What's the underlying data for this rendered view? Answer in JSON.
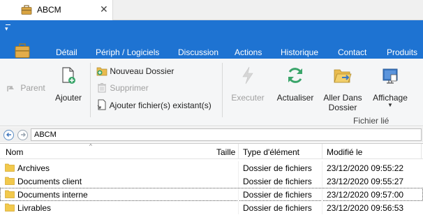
{
  "window": {
    "tab_title": "ABCM",
    "tab_close": "✕"
  },
  "ribbon": {
    "tabs": [
      "Détail",
      "Périph / Logiciels",
      "Discussion",
      "Actions",
      "Historique",
      "Contact",
      "Produits"
    ],
    "buttons": {
      "parent": "Parent",
      "ajouter": "Ajouter",
      "nouveau_dossier": "Nouveau Dossier",
      "supprimer": "Supprimer",
      "ajouter_fichiers": "Ajouter fichier(s) existant(s)",
      "executer": "Executer",
      "actualiser": "Actualiser",
      "aller_dans_1": "Aller Dans",
      "aller_dans_2": "Dossier",
      "affichage": "Affichage"
    },
    "group_label": "Fichier lié"
  },
  "address": {
    "value": "ABCM"
  },
  "list": {
    "columns": {
      "name": "Nom",
      "size": "Taille",
      "type": "Type d'élément",
      "modified": "Modifié le"
    },
    "rows": [
      {
        "name": "Archives",
        "size": "",
        "type": "Dossier de fichiers",
        "modified": "23/12/2020 09:55:22"
      },
      {
        "name": "Documents client",
        "size": "",
        "type": "Dossier de fichiers",
        "modified": "23/12/2020 09:55:27"
      },
      {
        "name": "Documents interne",
        "size": "",
        "type": "Dossier de fichiers",
        "modified": "23/12/2020 09:57:00"
      },
      {
        "name": "Livrables",
        "size": "",
        "type": "Dossier de fichiers",
        "modified": "23/12/2020 09:56:53"
      }
    ]
  },
  "colors": {
    "ribbon_blue": "#1e73d2",
    "folder_yellow": "#f2c94c",
    "refresh_green": "#3aa56a",
    "disabled_gray": "#a0a0a0"
  },
  "icons": {
    "tab": "briefcase-icon",
    "parent": "arrow-up-icon",
    "ajouter": "add-file-icon",
    "nouveau_dossier": "new-folder-icon",
    "supprimer": "trash-icon",
    "ajouter_fichiers": "attach-file-icon",
    "executer": "lightning-icon",
    "actualiser": "refresh-icon",
    "aller_dans": "open-folder-icon",
    "affichage": "display-icon",
    "back": "back-arrow-icon",
    "forward": "forward-arrow-icon",
    "folder": "folder-icon"
  }
}
